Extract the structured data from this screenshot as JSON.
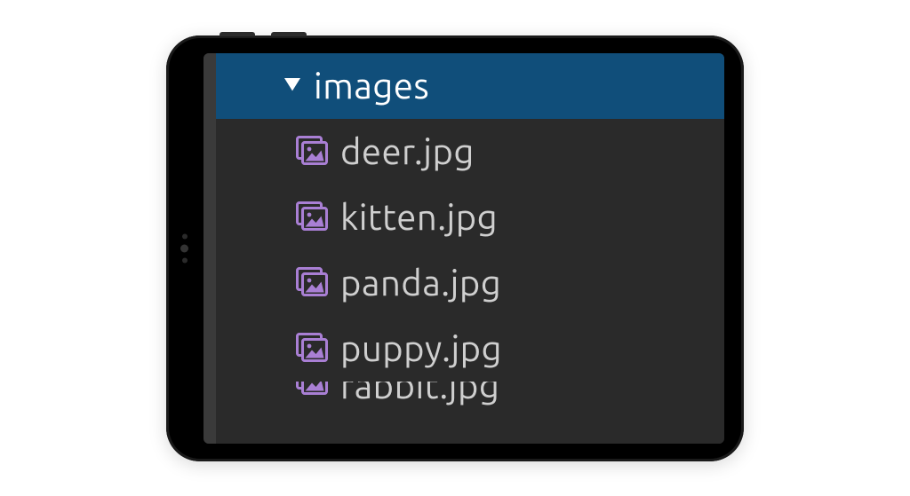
{
  "folder": {
    "name": "images",
    "expanded": true
  },
  "files": [
    {
      "name": "deer.jpg"
    },
    {
      "name": "kitten.jpg"
    },
    {
      "name": "panda.jpg"
    },
    {
      "name": "puppy.jpg"
    },
    {
      "name": "rabbit.jpg"
    }
  ],
  "colors": {
    "selection": "#104e7a",
    "panel": "#2a2a2a",
    "iconPurple": "#a97fd4"
  }
}
